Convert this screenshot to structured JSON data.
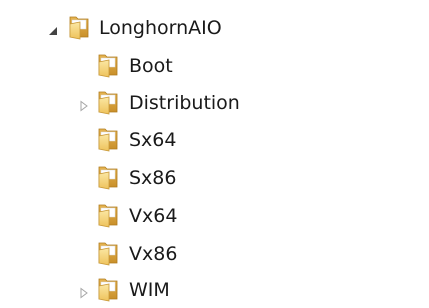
{
  "tree": {
    "root": {
      "label": "LonghornAIO",
      "expanded": true,
      "icon": "folder-icon"
    },
    "children": [
      {
        "label": "Boot",
        "has_children": false,
        "icon": "folder-icon"
      },
      {
        "label": "Distribution",
        "has_children": true,
        "expanded": false,
        "icon": "folder-icon"
      },
      {
        "label": "Sx64",
        "has_children": false,
        "icon": "folder-icon"
      },
      {
        "label": "Sx86",
        "has_children": false,
        "icon": "folder-icon"
      },
      {
        "label": "Vx64",
        "has_children": false,
        "icon": "folder-icon"
      },
      {
        "label": "Vx86",
        "has_children": false,
        "icon": "folder-icon"
      },
      {
        "label": "WIM",
        "has_children": true,
        "expanded": false,
        "icon": "folder-icon"
      }
    ]
  },
  "colors": {
    "folder_back": "#d9a63c",
    "folder_front": "#f6d77c",
    "folder_highlight": "#fbe9a8",
    "expander_expanded": "#444444",
    "expander_collapsed": "#a6a6a6",
    "text": "#1a1a1a"
  }
}
